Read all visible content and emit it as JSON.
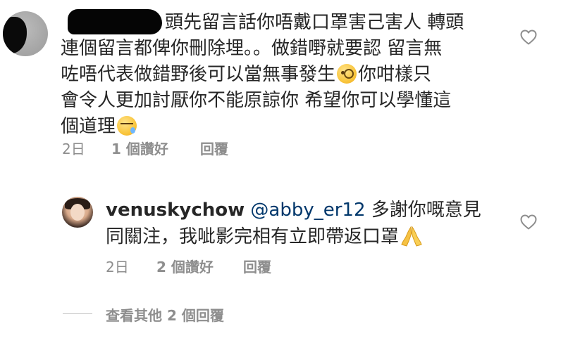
{
  "comment": {
    "lines": [
      "頭先留言話你唔戴口罩害己害人 轉頭",
      "連個留言都俾你刪除埋。。做錯嘢就要認 留言無",
      "咗唔代表做錯野後可以當無事發生",
      "你咁樣只",
      "會令人更加討厭你不能原諒你 希望你可以學懂這",
      "個道理"
    ],
    "time": "2日",
    "likes": "1 個讚好",
    "reply_label": "回覆",
    "emojis": [
      "face-with-monocle-emoji",
      "sleepy-face-emoji"
    ]
  },
  "reply": {
    "username": "venuskychow",
    "mention": "@abby_er12",
    "text_line1": " 多謝你嘅意見",
    "text_line2": "同關注，我呲影完相有立即帶返口罩",
    "emoji": "folded-hands-emoji",
    "time": "2日",
    "likes": "2 個讚好",
    "reply_label": "回覆"
  },
  "view_more": "查看其他 2 個回覆",
  "colors": {
    "text": "#262626",
    "secondary": "#8e8e8e",
    "mention": "#00376b"
  }
}
